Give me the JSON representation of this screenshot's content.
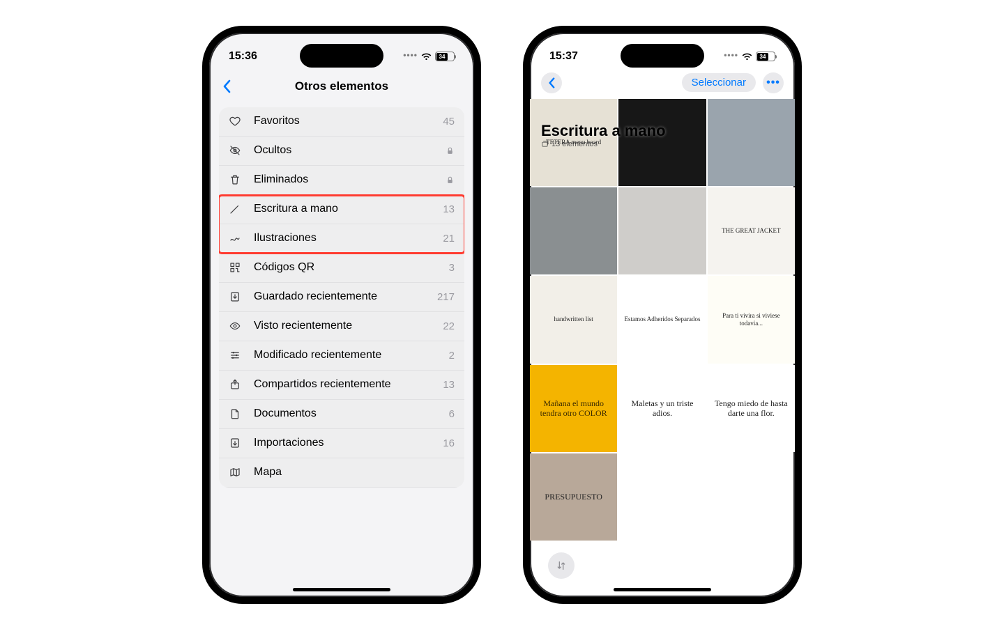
{
  "phone1": {
    "time": "15:36",
    "battery": "34",
    "title": "Otros elementos",
    "rows": [
      {
        "icon": "heart",
        "label": "Favoritos",
        "count": "45",
        "lock": false
      },
      {
        "icon": "eyeoff",
        "label": "Ocultos",
        "count": "",
        "lock": true
      },
      {
        "icon": "trash",
        "label": "Eliminados",
        "count": "",
        "lock": true
      },
      {
        "icon": "pencil",
        "label": "Escritura a mano",
        "count": "13",
        "lock": false
      },
      {
        "icon": "scribble",
        "label": "Ilustraciones",
        "count": "21",
        "lock": false
      },
      {
        "icon": "qr",
        "label": "Códigos QR",
        "count": "3",
        "lock": false
      },
      {
        "icon": "download",
        "label": "Guardado recientemente",
        "count": "217",
        "lock": false
      },
      {
        "icon": "eye",
        "label": "Visto recientemente",
        "count": "22",
        "lock": false
      },
      {
        "icon": "sliders",
        "label": "Modificado recientemente",
        "count": "2",
        "lock": false
      },
      {
        "icon": "share",
        "label": "Compartidos recientemente",
        "count": "13",
        "lock": false
      },
      {
        "icon": "doc",
        "label": "Documentos",
        "count": "6",
        "lock": false
      },
      {
        "icon": "import",
        "label": "Importaciones",
        "count": "16",
        "lock": false
      },
      {
        "icon": "map",
        "label": "Mapa",
        "count": "",
        "lock": false
      }
    ],
    "highlight_from": 3,
    "highlight_to": 4
  },
  "phone2": {
    "time": "15:37",
    "battery": "34",
    "select_label": "Seleccionar",
    "album_title": "Escritura a mano",
    "album_subtitle": "13 elementos",
    "thumbs": [
      {
        "bg": "#e6e1d5",
        "txt": "TETERA menu board"
      },
      {
        "bg": "#171717",
        "txt": ""
      },
      {
        "bg": "#9aa4ad",
        "txt": ""
      },
      {
        "bg": "#8a8f91",
        "txt": ""
      },
      {
        "bg": "#cfcdca",
        "txt": ""
      },
      {
        "bg": "#f5f3ef",
        "txt": "THE GREAT JACKET"
      },
      {
        "bg": "#f2efe8",
        "txt": "handwritten list"
      },
      {
        "bg": "#ffffff",
        "txt": "Estamos Adheridos Separados"
      },
      {
        "bg": "#fefdf6",
        "txt": "Para ti vivira si viviese todavia..."
      },
      {
        "bg": "#f4b400",
        "txt": "Mañana el mundo tendra otro COLOR"
      },
      {
        "bg": "#ffffff",
        "txt": "Maletas y un triste adios."
      },
      {
        "bg": "#ffffff",
        "txt": "Tengo miedo de hasta darte una flor."
      },
      {
        "bg": "#b8a899",
        "txt": "PRESUPUESTO"
      }
    ]
  }
}
